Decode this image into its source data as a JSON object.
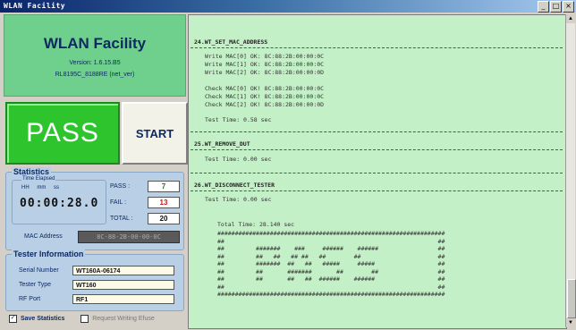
{
  "window": {
    "title": "WLAN Facility",
    "minimize": "_",
    "maximize": "□",
    "close": "×"
  },
  "header": {
    "app_title": "WLAN Facility",
    "version": "Version: 1.6.15.B5",
    "chip": "RL8195C_8188RE (net_ver)"
  },
  "result": {
    "status": "PASS",
    "start_label": "START"
  },
  "statistics": {
    "title": "Statistics",
    "time_elapsed_label": "Time Elapsed",
    "time_units": "HH mm ss",
    "time_value": "00:00:28.0",
    "pass_label": "PASS :",
    "pass_value": "7",
    "fail_label": "FAIL :",
    "fail_value": "13",
    "total_label": "TOTAL :",
    "total_value": "20",
    "mac_label": "MAC Address",
    "mac_value": "8C-88-2B-00-00-0C"
  },
  "tester": {
    "title": "Tester Information",
    "serial_label": "Serial Number",
    "serial_value": "WT160A-06174",
    "type_label": "Tester Type",
    "type_value": "WT160",
    "port_label": "RF Port",
    "port_value": "RF1"
  },
  "options": {
    "save_statistics": "Save Statistics",
    "save_checked": "✓",
    "request_writing": "Request Writing Efuse"
  },
  "log": {
    "sec24": "24.WT_SET_MAC_ADDRESS",
    "write0": "Write MAC[0] OK: 8C:88:2B:00:00:0C",
    "write1": "Write MAC[1] OK: 8C:88:2B:00:00:0C",
    "write2": "Write MAC[2] OK: 8C:88:2B:00:00:0D",
    "check0": "Check MAC[0] OK! 8C:88:2B:00:00:0C",
    "check1": "Check MAC[1] OK! 8C:88:2B:00:00:0C",
    "check2": "Check MAC[2] OK! 8C:88:2B:00:00:0D",
    "test_time_24": "Test Time: 0.58 sec",
    "sec25": "25.WT_REMOVE_DUT",
    "test_time_25": "Test Time: 0.00 sec",
    "sec26": "26.WT_DISCONNECT_TESTER",
    "test_time_26": "Test Time: 0.00 sec",
    "total_time": "Total Time: 28.140 sec",
    "ascii_pass": "#################################################################\n##                                                             ##\n##         #######    ###     ######    ######                 ##\n##         ##   ##   ## ##   ##        ##                      ##\n##         #######  ##   ##   #####     #####                  ##\n##         ##       #######       ##        ##                 ##\n##         ##       ##   ##  ######    ######                  ##\n##                                                             ##\n#################################################################"
  },
  "scrollbar": {
    "up": "▲",
    "down": "▼"
  }
}
